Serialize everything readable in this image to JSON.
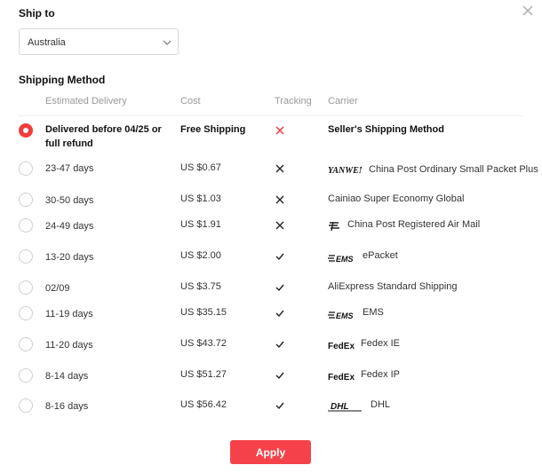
{
  "ship_to": {
    "label": "Ship to",
    "selected_country": "Australia"
  },
  "shipping_method": {
    "label": "Shipping Method",
    "columns": {
      "estimated_delivery": "Estimated Delivery",
      "cost": "Cost",
      "tracking": "Tracking",
      "carrier": "Carrier"
    },
    "options": [
      {
        "delivery": "Delivered before 04/25 or full refund",
        "cost": "Free Shipping",
        "tracking": "none",
        "carrier": "Seller's Shipping Method",
        "carrier_logo": "",
        "selected": true
      },
      {
        "delivery": "23-47 days",
        "cost": "US $0.67",
        "tracking": "no",
        "carrier": "China Post Ordinary Small Packet Plus",
        "carrier_logo": "YANWEN",
        "selected": false
      },
      {
        "delivery": "30-50 days",
        "cost": "US $1.03",
        "tracking": "no",
        "carrier": "Cainiao Super Economy Global",
        "carrier_logo": "",
        "selected": false
      },
      {
        "delivery": "24-49 days",
        "cost": "US $1.91",
        "tracking": "no",
        "carrier": "China Post Registered Air Mail",
        "carrier_logo": "china-post-icon",
        "selected": false
      },
      {
        "delivery": "13-20 days",
        "cost": "US $2.00",
        "tracking": "yes",
        "carrier": "ePacket",
        "carrier_logo": "EMS",
        "selected": false
      },
      {
        "delivery": "02/09",
        "cost": "US $3.75",
        "tracking": "yes",
        "carrier": "AliExpress Standard Shipping",
        "carrier_logo": "",
        "selected": false
      },
      {
        "delivery": "11-19 days",
        "cost": "US $35.15",
        "tracking": "yes",
        "carrier": "EMS",
        "carrier_logo": "EMS",
        "selected": false
      },
      {
        "delivery": "11-20 days",
        "cost": "US $43.72",
        "tracking": "yes",
        "carrier": "Fedex IE",
        "carrier_logo": "FedEx",
        "selected": false
      },
      {
        "delivery": "8-14 days",
        "cost": "US $51.27",
        "tracking": "yes",
        "carrier": "Fedex IP",
        "carrier_logo": "FedEx",
        "selected": false
      },
      {
        "delivery": "8-16 days",
        "cost": "US $56.42",
        "tracking": "yes",
        "carrier": "DHL",
        "carrier_logo": "DHL",
        "selected": false
      }
    ]
  },
  "apply_label": "Apply",
  "colors": {
    "accent": "#f5424a",
    "radio_selected": "#f23c3c",
    "tracking_none": "#f23c3c",
    "muted_text": "#999999"
  }
}
